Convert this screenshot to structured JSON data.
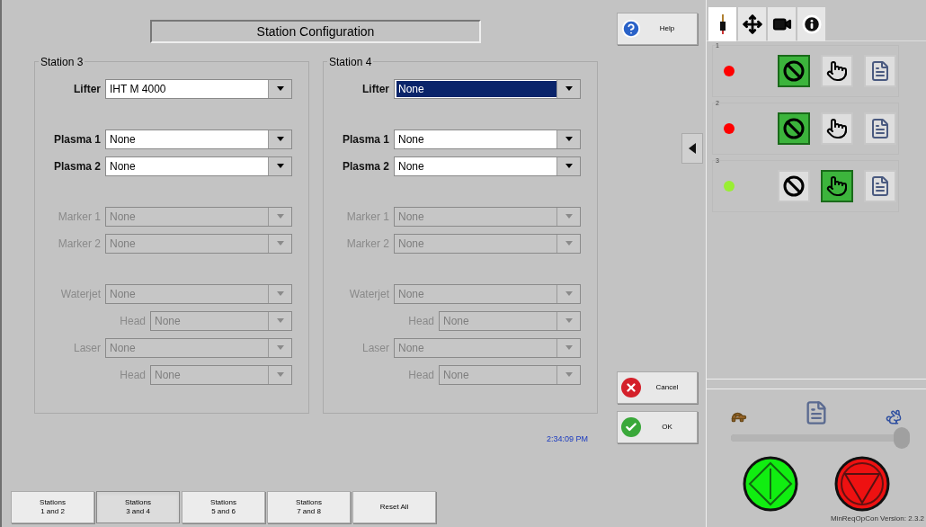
{
  "title": "Station Configuration",
  "stations": [
    {
      "name": "Station 3",
      "groups": [
        [
          {
            "label": "Lifter",
            "value": "IHT M 4000",
            "kind": "main",
            "enabled": true,
            "focused": false
          }
        ],
        [
          {
            "label": "Plasma 1",
            "value": "None",
            "kind": "main",
            "enabled": true,
            "focused": false
          },
          {
            "label": "Plasma 2",
            "value": "None",
            "kind": "main",
            "enabled": true,
            "focused": false
          }
        ],
        [
          {
            "label": "Marker 1",
            "value": "None",
            "kind": "main",
            "enabled": false,
            "focused": false
          },
          {
            "label": "Marker 2",
            "value": "None",
            "kind": "main",
            "enabled": false,
            "focused": false
          }
        ],
        [
          {
            "label": "Waterjet",
            "value": "None",
            "kind": "main",
            "enabled": false,
            "focused": false
          },
          {
            "label": "Head",
            "value": "None",
            "kind": "sub",
            "enabled": false,
            "focused": false
          },
          {
            "label": "Laser",
            "value": "None",
            "kind": "main",
            "enabled": false,
            "focused": false
          },
          {
            "label": "Head",
            "value": "None",
            "kind": "sub",
            "enabled": false,
            "focused": false
          }
        ]
      ]
    },
    {
      "name": "Station 4",
      "groups": [
        [
          {
            "label": "Lifter",
            "value": "None",
            "kind": "main",
            "enabled": true,
            "focused": true
          }
        ],
        [
          {
            "label": "Plasma 1",
            "value": "None",
            "kind": "main",
            "enabled": true,
            "focused": false
          },
          {
            "label": "Plasma 2",
            "value": "None",
            "kind": "main",
            "enabled": true,
            "focused": false
          }
        ],
        [
          {
            "label": "Marker 1",
            "value": "None",
            "kind": "main",
            "enabled": false,
            "focused": false
          },
          {
            "label": "Marker 2",
            "value": "None",
            "kind": "main",
            "enabled": false,
            "focused": false
          }
        ],
        [
          {
            "label": "Waterjet",
            "value": "None",
            "kind": "main",
            "enabled": false,
            "focused": false
          },
          {
            "label": "Head",
            "value": "None",
            "kind": "sub",
            "enabled": false,
            "focused": false
          },
          {
            "label": "Laser",
            "value": "None",
            "kind": "main",
            "enabled": false,
            "focused": false
          },
          {
            "label": "Head",
            "value": "None",
            "kind": "sub",
            "enabled": false,
            "focused": false
          }
        ]
      ]
    }
  ],
  "time": "2:34:09 PM",
  "bottom_buttons": [
    {
      "lines": [
        "Stations",
        "1 and 2"
      ],
      "selected": false
    },
    {
      "lines": [
        "Stations",
        "3 and 4"
      ],
      "selected": true
    },
    {
      "lines": [
        "Stations",
        "5 and 6"
      ],
      "selected": false
    },
    {
      "lines": [
        "Stations",
        "7 and 8"
      ],
      "selected": false
    },
    {
      "lines": [
        "Reset All"
      ],
      "selected": false
    }
  ],
  "help_button": "Help",
  "cancel_button": "Cancel",
  "ok_button": "OK",
  "tabs": [
    {
      "kind": "torch",
      "selected": true
    },
    {
      "kind": "move",
      "selected": false
    },
    {
      "kind": "camera",
      "selected": false
    },
    {
      "kind": "info",
      "selected": false
    }
  ],
  "station_rows": [
    {
      "number": "1",
      "color": "#ff0000",
      "buttons": [
        {
          "kind": "disable",
          "active": true
        },
        {
          "kind": "manual",
          "active": false
        },
        {
          "kind": "program",
          "active": false
        }
      ]
    },
    {
      "number": "2",
      "color": "#ff0000",
      "buttons": [
        {
          "kind": "disable",
          "active": true
        },
        {
          "kind": "manual",
          "active": false
        },
        {
          "kind": "program",
          "active": false
        }
      ]
    },
    {
      "number": "3",
      "color": "#99ee33",
      "buttons": [
        {
          "kind": "disable",
          "active": false
        },
        {
          "kind": "manual",
          "active": true
        },
        {
          "kind": "program",
          "active": false
        }
      ]
    }
  ],
  "speed": {
    "level": 1
  },
  "version": "MinReqOpCon Version: 2.3.2"
}
